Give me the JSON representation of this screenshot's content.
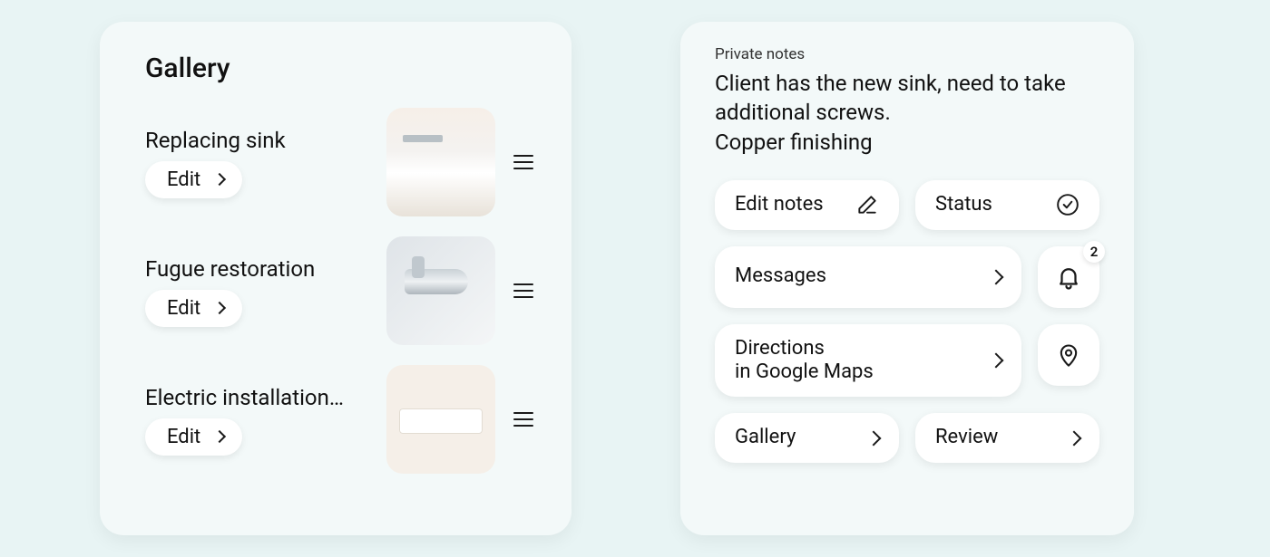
{
  "gallery": {
    "title": "Gallery",
    "edit_label": "Edit",
    "items": [
      {
        "title": "Replacing sink",
        "thumb": "sink"
      },
      {
        "title": "Fugue restoration",
        "thumb": "faucet"
      },
      {
        "title": "Electric installation…",
        "thumb": "electric"
      }
    ]
  },
  "notes": {
    "label": "Private notes",
    "body": "Client has the new sink, need to take additional screws.\nCopper finishing",
    "edit_notes_label": "Edit notes",
    "status_label": "Status",
    "messages_label": "Messages",
    "notifications_count": "2",
    "directions_label": "Directions\nin Google Maps",
    "gallery_label": "Gallery",
    "review_label": "Review"
  }
}
